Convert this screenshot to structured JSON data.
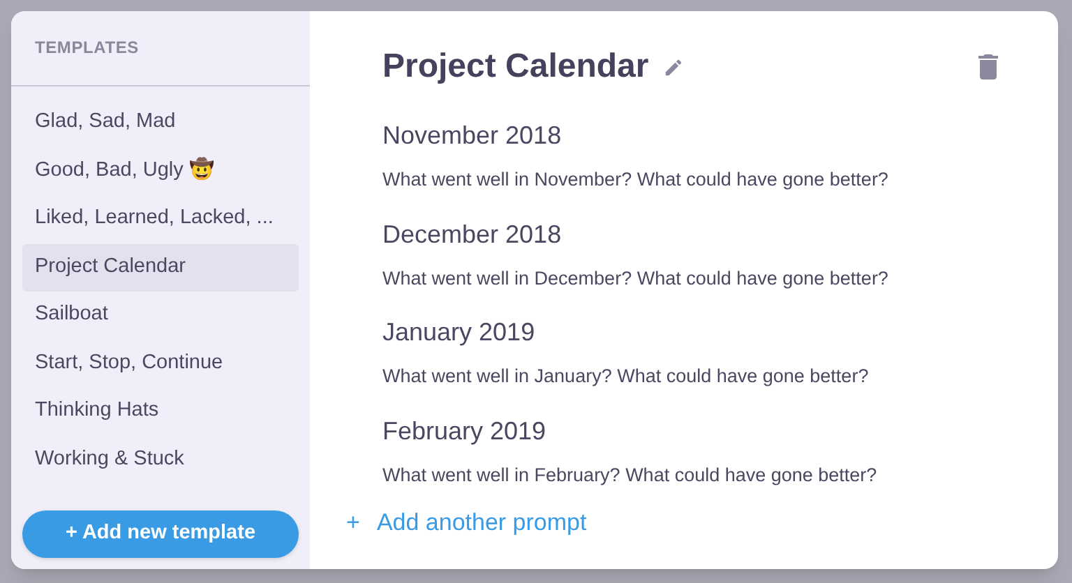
{
  "sidebar": {
    "heading": "TEMPLATES",
    "items": [
      {
        "label": "Glad, Sad, Mad",
        "selected": false
      },
      {
        "label": "Good, Bad, Ugly 🤠",
        "selected": false
      },
      {
        "label": "Liked, Learned, Lacked, ...",
        "selected": false
      },
      {
        "label": "Project Calendar",
        "selected": true
      },
      {
        "label": "Sailboat",
        "selected": false
      },
      {
        "label": "Start, Stop, Continue",
        "selected": false
      },
      {
        "label": "Thinking Hats",
        "selected": false
      },
      {
        "label": "Working & Stuck",
        "selected": false
      }
    ],
    "add_button": "+ Add new template"
  },
  "editor": {
    "title": "Project Calendar",
    "prompts": [
      {
        "heading": "November 2018",
        "question": "What went well in November? What could have gone better?"
      },
      {
        "heading": "December 2018",
        "question": "What went well in December? What could have gone better?"
      },
      {
        "heading": "January 2019",
        "question": "What went well in January? What could have gone better?"
      },
      {
        "heading": "February 2019",
        "question": "What went well in February? What could have gone better?"
      }
    ],
    "add_prompt": {
      "icon": "+",
      "label": "Add another prompt"
    }
  }
}
